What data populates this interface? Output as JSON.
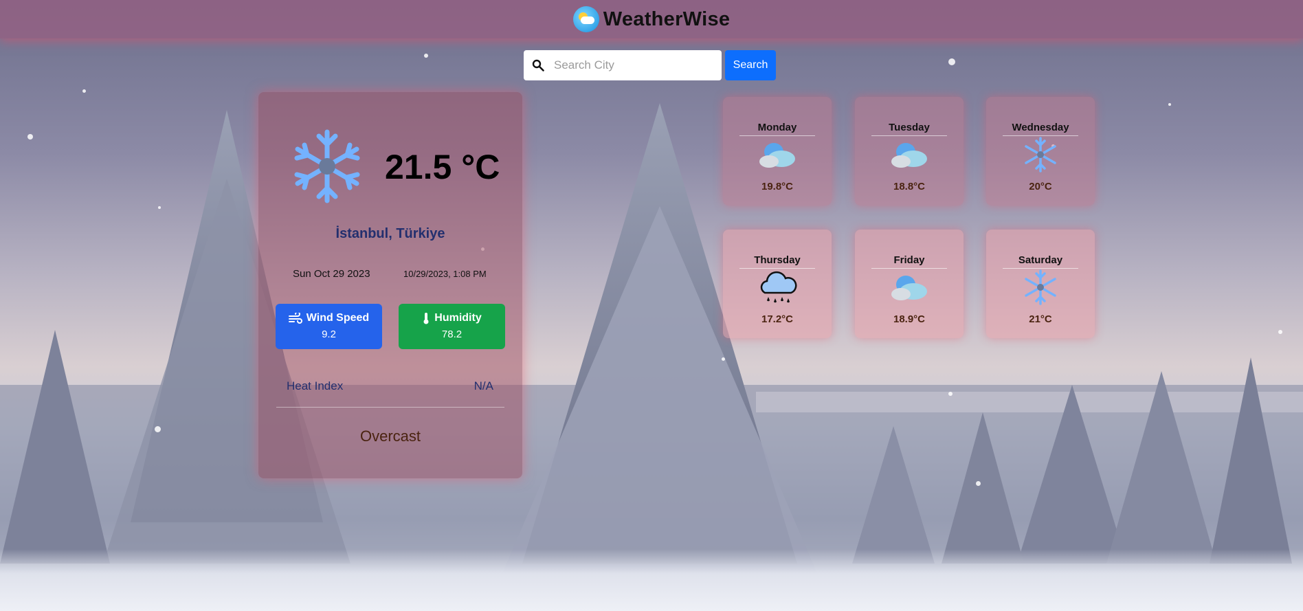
{
  "app": {
    "title": "WeatherWise",
    "logo_icon": "weather-logo-icon"
  },
  "search": {
    "placeholder": "Search City",
    "value": "",
    "button_label": "Search",
    "icon": "search-icon"
  },
  "current": {
    "icon": "snowflake-icon",
    "temperature": "21.5 °C",
    "location": "İstanbul, Türkiye",
    "date": "Sun Oct 29 2023",
    "datetime": "10/29/2023, 1:08 PM",
    "wind": {
      "label": "Wind Speed",
      "value": "9.2",
      "icon": "wind-icon",
      "color": "#2563eb"
    },
    "humidity": {
      "label": "Humidity",
      "value": "78.2",
      "icon": "thermometer-icon",
      "color": "#16a34a"
    },
    "heat_index": {
      "label": "Heat Index",
      "value": "N/A"
    },
    "condition": "Overcast"
  },
  "forecast": [
    {
      "day": "Monday",
      "temp": "19.8°C",
      "icon": "cloudy-icon"
    },
    {
      "day": "Tuesday",
      "temp": "18.8°C",
      "icon": "cloudy-icon"
    },
    {
      "day": "Wednesday",
      "temp": "20°C",
      "icon": "snowflake-icon"
    },
    {
      "day": "Thursday",
      "temp": "17.2°C",
      "icon": "rain-cloud-icon"
    },
    {
      "day": "Friday",
      "temp": "18.9°C",
      "icon": "cloudy-icon"
    },
    {
      "day": "Saturday",
      "temp": "21°C",
      "icon": "snowflake-icon"
    }
  ]
}
